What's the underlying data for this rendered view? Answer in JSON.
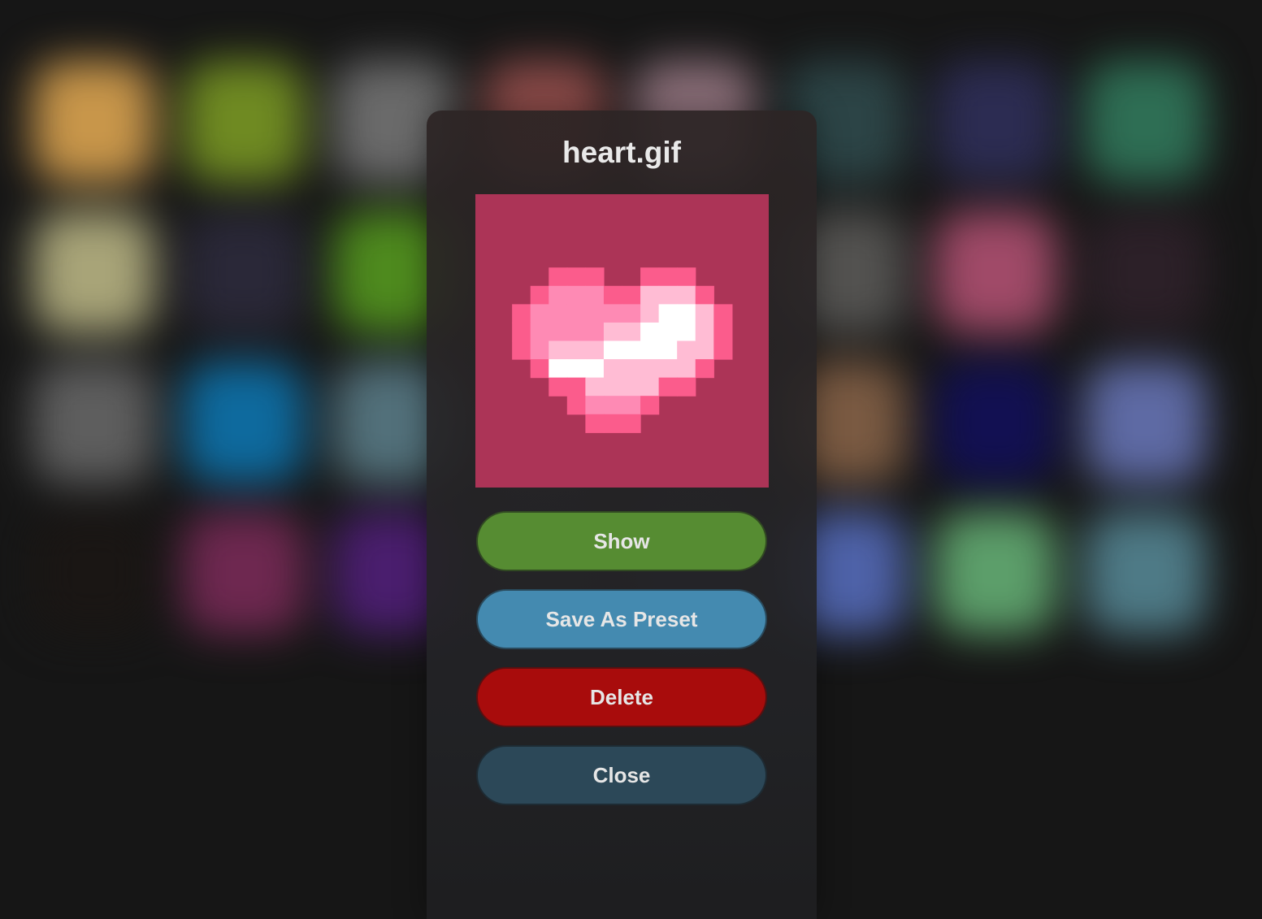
{
  "background": {
    "tiles": [
      "#c8964a",
      "#6f8a22",
      "#6a6a6a",
      "#8a4a48",
      "#8a6e78",
      "#2c4446",
      "#2c2c52",
      "#2e6e54",
      "#a8a478",
      "#2a2838",
      "#4e8a1e",
      "#2a262e",
      "#2b2a2b",
      "#535250",
      "#a04a68",
      "#2c2028",
      "#5e5e5e",
      "#0e6a9e",
      "#52707a",
      "#2c2c30",
      "#24242a",
      "#7a5a42",
      "#121052",
      "#5e6aa4",
      "#1a1614",
      "#6e2850",
      "#4a1e6e",
      "#26262a",
      "#2a2e44",
      "#4e62a8",
      "#5c9e6a",
      "#4e7a86"
    ],
    "base_color": "#161616"
  },
  "modal": {
    "title": "heart.gif",
    "preview": {
      "name": "heart-pixel-art",
      "grid_size": 16,
      "background_color": "#ac3457",
      "palette": {
        "D": "#fb5c8c",
        "M": "#fe8ab4",
        "L": "#ffbcd4",
        "W": "#ffffff"
      },
      "rows": [
        "................",
        "................",
        "................",
        "................",
        "....DDD..DDD....",
        "...DMMMDDLLLD...",
        "..DMMMMMMLWWLD..",
        "..DMMMMLLWWWLD..",
        "..DMLLLWWWWLLD..",
        "...DWWWLLLLLD...",
        "....DDLLLLDD....",
        ".....DMMMD......",
        "......DDD.......",
        "................",
        "................",
        "................"
      ]
    },
    "buttons": [
      {
        "id": "show",
        "label": "Show",
        "color": "#568c32"
      },
      {
        "id": "save_preset",
        "label": "Save As Preset",
        "color": "#448ab0"
      },
      {
        "id": "delete",
        "label": "Delete",
        "color": "#a80c0c"
      },
      {
        "id": "close",
        "label": "Close",
        "color": "#2c4858"
      }
    ]
  }
}
